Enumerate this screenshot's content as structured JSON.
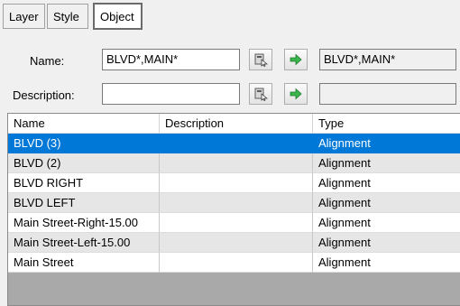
{
  "tabs": [
    {
      "label": "Layer"
    },
    {
      "label": "Style"
    },
    {
      "label": "Object"
    }
  ],
  "name_filter": {
    "label": "Name:",
    "value": "BLVD*,MAIN*",
    "result": "BLVD*,MAIN*"
  },
  "description_filter": {
    "label": "Description:",
    "value": "",
    "result": ""
  },
  "icons": {
    "pick_icon": "pick-from-drawing-icon",
    "apply_icon": "green-arrow-right-icon"
  },
  "table": {
    "columns": [
      "Name",
      "Description",
      "Type"
    ],
    "rows": [
      {
        "name": "BLVD (3)",
        "description": "",
        "type": "Alignment",
        "selected": true
      },
      {
        "name": "BLVD (2)",
        "description": "",
        "type": "Alignment",
        "selected": false
      },
      {
        "name": "BLVD RIGHT",
        "description": "",
        "type": "Alignment",
        "selected": false
      },
      {
        "name": "BLVD LEFT",
        "description": "",
        "type": "Alignment",
        "selected": false
      },
      {
        "name": "Main Street-Right-15.00",
        "description": "",
        "type": "Alignment",
        "selected": false
      },
      {
        "name": "Main Street-Left-15.00",
        "description": "",
        "type": "Alignment",
        "selected": false
      },
      {
        "name": "Main Street",
        "description": "",
        "type": "Alignment",
        "selected": false
      }
    ]
  },
  "colors": {
    "selection": "#0078d7",
    "arrow": "#2ea043"
  }
}
